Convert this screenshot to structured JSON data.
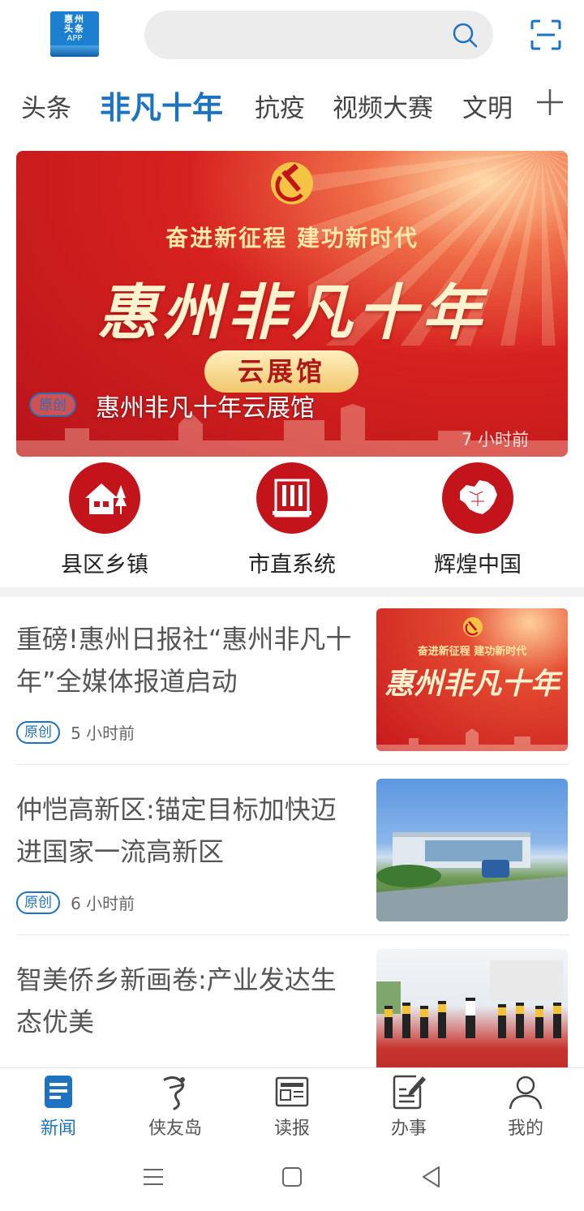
{
  "header": {
    "logo_line1": "惠州",
    "logo_line2": "头条",
    "logo_line3": "APP",
    "search_placeholder": ""
  },
  "tabs": [
    {
      "label": "头条",
      "active": false
    },
    {
      "label": "非凡十年",
      "active": true
    },
    {
      "label": "抗疫",
      "active": false
    },
    {
      "label": "视频大赛",
      "active": false
    },
    {
      "label": "文明",
      "active": false
    }
  ],
  "banner": {
    "slogan": "奋进新征程  建功新时代",
    "calligraphy": "惠州非凡十年",
    "pill": "云展馆",
    "tag": "原创",
    "title": "惠州非凡十年云展馆",
    "time": "7 小时前"
  },
  "categories": [
    {
      "label": "县区乡镇",
      "icon": "house-icon"
    },
    {
      "label": "市直系统",
      "icon": "building-icon"
    },
    {
      "label": "辉煌中国",
      "icon": "china-map-icon"
    }
  ],
  "news": [
    {
      "title": "重磅!惠州日报社“惠州非凡十年”全媒体报道启动",
      "tag": "原创",
      "time": "5 小时前",
      "thumb_slogan": "奋进新征程  建功新时代",
      "thumb_calligraphy": "惠州非凡十年"
    },
    {
      "title": "仲恺高新区:锚定目标加快迈进国家一流高新区",
      "tag": "原创",
      "time": "6 小时前"
    },
    {
      "title": "智美侨乡新画卷:产业发达生态优美",
      "tag": "",
      "time": ""
    }
  ],
  "bottom_nav": [
    {
      "label": "新闻",
      "icon": "news-icon",
      "active": true
    },
    {
      "label": "侠友岛",
      "icon": "xiayoudao-icon",
      "active": false
    },
    {
      "label": "读报",
      "icon": "newspaper-icon",
      "active": false
    },
    {
      "label": "办事",
      "icon": "services-icon",
      "active": false
    },
    {
      "label": "我的",
      "icon": "profile-icon",
      "active": false
    }
  ],
  "colors": {
    "accent": "#1d72c2",
    "brand_red": "#c4141b"
  }
}
